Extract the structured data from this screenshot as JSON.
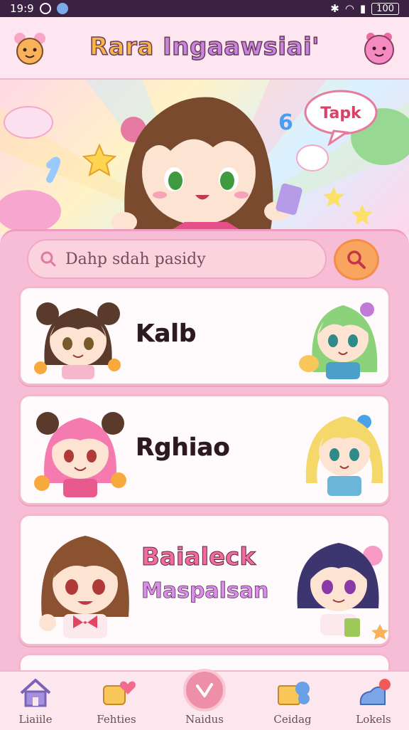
{
  "status_bar": {
    "time": "19:9",
    "battery": "100"
  },
  "header": {
    "title_part1": "Rara ",
    "title_part2": "Ingaawsiai'"
  },
  "hero": {
    "speech_bubble": "Tapk"
  },
  "search": {
    "placeholder": "Dahp sdah pasidy"
  },
  "cards": [
    {
      "name": "Kalb"
    },
    {
      "name": "Rghiao"
    },
    {
      "name_line1": "Baialeck",
      "name_line2": "Maspalsan"
    }
  ],
  "nav": {
    "items": [
      {
        "label": "Liaiile"
      },
      {
        "label": "Fehties"
      },
      {
        "label": "Naidus"
      },
      {
        "label": "Ceidag"
      },
      {
        "label": "Lokels"
      }
    ]
  },
  "colors": {
    "accent_orange": "#f8a55f",
    "panel_pink": "#f7bdd6",
    "nav_center": "#ee8fa8"
  }
}
